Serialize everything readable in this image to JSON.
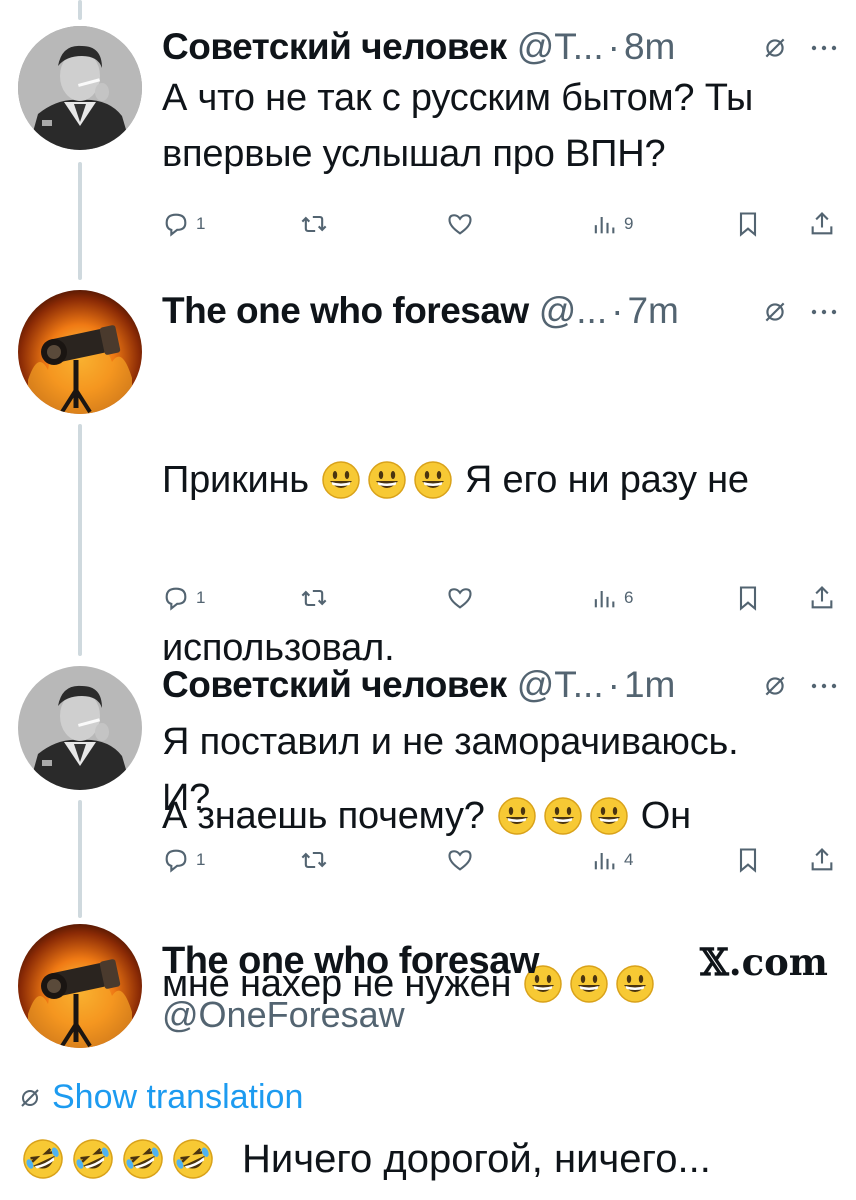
{
  "tweets": [
    {
      "name": "Советский человек",
      "handle": "@T...",
      "time": "8m",
      "text_lines": [
        "А что не так с русским бытом? Ты",
        "впервые услышал про ВПН?"
      ],
      "replies": "1",
      "views": "9"
    },
    {
      "name": "The one who foresaw",
      "handle": "@...",
      "time": "7m",
      "text_lines": [
        "Прикинь",
        "Я его ни разу не",
        "использовал.",
        "А знаешь почему?",
        "Он",
        "мне нахер не нужен"
      ],
      "replies": "1",
      "views": "6"
    },
    {
      "name": "Советский человек",
      "handle": "@T...",
      "time": "1m",
      "text_lines": [
        "Я поставил и не заморачиваюсь.",
        "И?"
      ],
      "replies": "1",
      "views": "4"
    }
  ],
  "main_tweet": {
    "name": "The one who foresaw",
    "handle": "@OneForesaw",
    "site": "𝕏.com",
    "show_translation": "Show translation",
    "text": "Ничего дорогой, ничего..."
  },
  "icons": {
    "reply": "reply-icon",
    "retweet": "retweet-icon",
    "like": "heart-icon",
    "views": "views-icon",
    "bookmark": "bookmark-icon",
    "share": "share-icon",
    "globe": "globe-icon",
    "more": "more-icon",
    "smile_emoji": "grinning-face-emoji",
    "rofl_emoji": "rolling-laughing-emoji"
  },
  "colors": {
    "text": "#0f1419",
    "secondary": "#536471",
    "link": "#1d9bf0",
    "thread_line": "#cfd9de"
  }
}
